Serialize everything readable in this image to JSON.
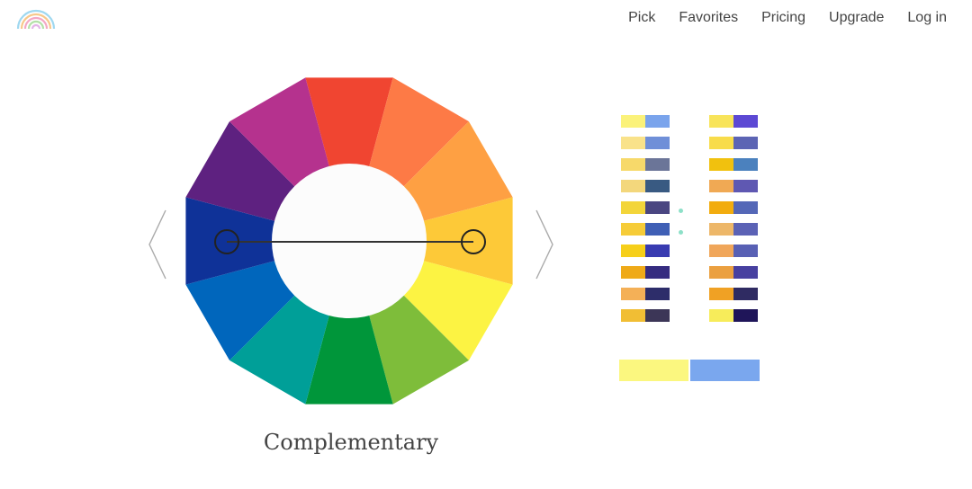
{
  "nav": {
    "items": [
      {
        "label": "Pick"
      },
      {
        "label": "Favorites"
      },
      {
        "label": "Pricing"
      },
      {
        "label": "Upgrade"
      },
      {
        "label": "Log in"
      }
    ]
  },
  "wheel": {
    "segments": [
      "#f04531",
      "#fd7a46",
      "#fea043",
      "#fdc938",
      "#fcf343",
      "#7ebd3a",
      "#00963a",
      "#009f98",
      "#0066bc",
      "#0f3298",
      "#5e2180",
      "#b5328e"
    ],
    "center_color": "#fcfcfc",
    "selector_line": {
      "from": "blue",
      "to": "yellow-orange"
    }
  },
  "scheme": {
    "name": "Complementary"
  },
  "pairs": {
    "col1": [
      [
        "#fbf27a",
        "#7aa4ec"
      ],
      [
        "#f9e28a",
        "#6f8fd8"
      ],
      [
        "#f7d96a",
        "#6b7598"
      ],
      [
        "#f3d77c",
        "#395a82"
      ],
      [
        "#f3d53a",
        "#4a4681"
      ],
      [
        "#f6cc38",
        "#3f5fb5"
      ],
      [
        "#f6cf1a",
        "#383bb1"
      ],
      [
        "#efaa18",
        "#352c80"
      ],
      [
        "#f4b057",
        "#2d2d6a"
      ],
      [
        "#f1be34",
        "#3c3657"
      ]
    ],
    "col2": [
      [
        "#f8e45a",
        "#5c49d4"
      ],
      [
        "#f8dc4a",
        "#5c64b4"
      ],
      [
        "#f1c10e",
        "#4b81be"
      ],
      [
        "#f0a954",
        "#5f58b2"
      ],
      [
        "#f2ac0e",
        "#5467b7"
      ],
      [
        "#edb769",
        "#5b62b5"
      ],
      [
        "#f0a65a",
        "#5860b4"
      ],
      [
        "#eba040",
        "#4740a0"
      ],
      [
        "#f0a124",
        "#2f2b62"
      ],
      [
        "#f7ec5a",
        "#1f1559"
      ]
    ]
  },
  "preview": {
    "color_a": "#fbf77f",
    "color_b": "#7aa7ee"
  }
}
